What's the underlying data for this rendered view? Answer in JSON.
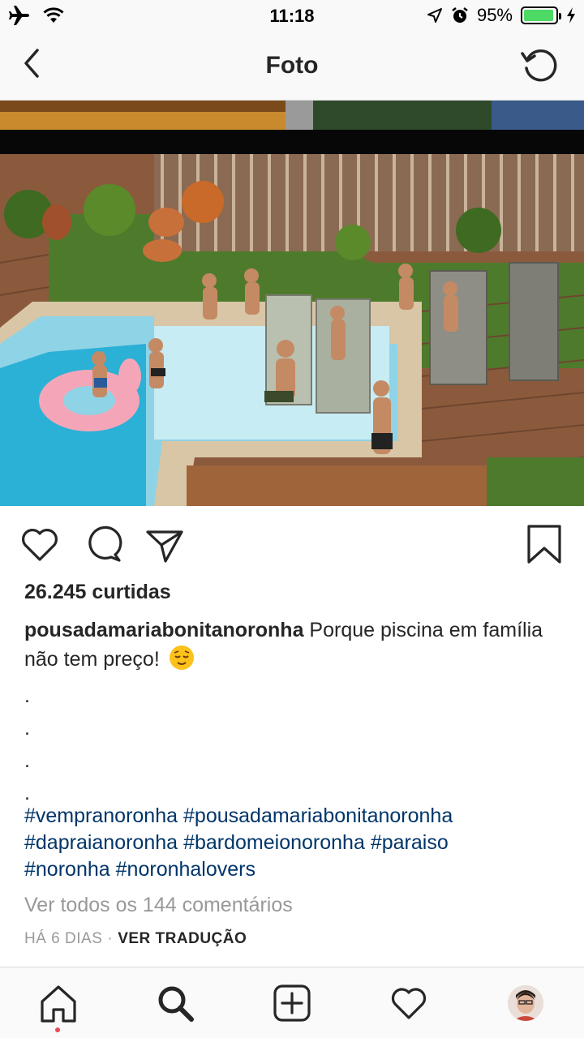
{
  "status_bar": {
    "time": "11:18",
    "battery_percent": "95%",
    "battery_level": 0.95,
    "icons": [
      "airplane-icon",
      "wifi-icon",
      "location-icon",
      "alarm-icon",
      "battery-icon",
      "charging-icon"
    ]
  },
  "header": {
    "title": "Foto",
    "back_icon": "chevron-left-icon",
    "refresh_icon": "refresh-icon"
  },
  "post": {
    "likes": "26.245 curtidas",
    "username": "pousadamariabonitanoronha",
    "caption_text": " Porque piscina em família não tem preço!",
    "caption_emoji": "relieved-face-emoji",
    "dots": [
      ".",
      ".",
      ".",
      "."
    ],
    "hashtags": [
      "#vempranoronha",
      "#pousadamariabonitanoronha",
      "#dapraianoronha",
      "#bardomeionoronha",
      "#paraiso",
      "#noronha",
      "#noronhalovers"
    ],
    "view_comments": "Ver todos os 144 comentários",
    "time_ago": "HÁ 6 DIAS",
    "separator": "·",
    "translate": "VER TRADUÇÃO"
  },
  "actions": [
    "heart-icon",
    "comment-icon",
    "share-icon",
    "bookmark-icon"
  ],
  "tabbar": [
    "home-icon",
    "search-icon",
    "add-icon",
    "activity-heart-icon",
    "profile-avatar"
  ],
  "colors": {
    "hashtag": "#003569",
    "muted": "#999999",
    "text": "#262626",
    "notification_dot": "#ed4956",
    "battery": "#4cd964"
  }
}
